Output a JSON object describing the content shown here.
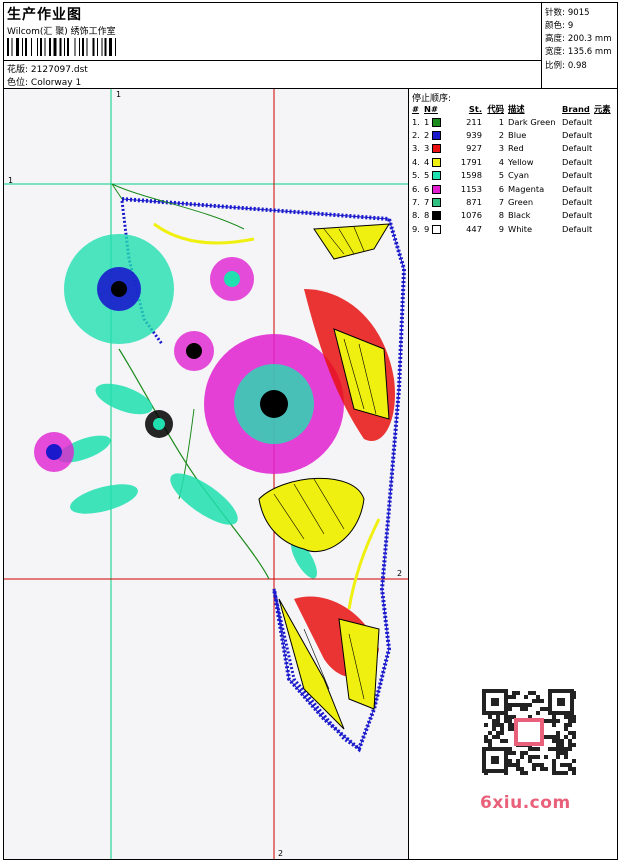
{
  "header": {
    "title": "生产作业图",
    "company": "Wilcom(汇 聚) 绣饰工作室",
    "design_label": "花版:",
    "design_value": "2127097.dst",
    "colorway_label": "色位:",
    "colorway_value": "Colorway 1"
  },
  "stats": [
    {
      "label": "针数:",
      "value": "9015"
    },
    {
      "label": "颜色:",
      "value": "9"
    },
    {
      "label": "高度:",
      "value": "200.3 mm"
    },
    {
      "label": "宽度:",
      "value": "135.6 mm"
    },
    {
      "label": "比例:",
      "value": "0.98"
    }
  ],
  "legend": {
    "title": "停止顺序:",
    "columns": [
      "#",
      "N#",
      "St.",
      "代码",
      "描述",
      "Brand",
      "元素"
    ],
    "rows": [
      {
        "n": "1.",
        "nn": "1",
        "color": "#1a8a1a",
        "st": "211",
        "code": "1",
        "desc": "Dark Green",
        "brand": "Default"
      },
      {
        "n": "2.",
        "nn": "2",
        "color": "#1a1acc",
        "st": "939",
        "code": "2",
        "desc": "Blue",
        "brand": "Default"
      },
      {
        "n": "3.",
        "nn": "3",
        "color": "#e81010",
        "st": "927",
        "code": "3",
        "desc": "Red",
        "brand": "Default"
      },
      {
        "n": "4.",
        "nn": "4",
        "color": "#f0f010",
        "st": "1791",
        "code": "4",
        "desc": "Yellow",
        "brand": "Default"
      },
      {
        "n": "5.",
        "nn": "5",
        "color": "#20e0b0",
        "st": "1598",
        "code": "5",
        "desc": "Cyan",
        "brand": "Default"
      },
      {
        "n": "6.",
        "nn": "6",
        "color": "#e020d0",
        "st": "1153",
        "code": "6",
        "desc": "Magenta",
        "brand": "Default"
      },
      {
        "n": "7.",
        "nn": "7",
        "color": "#30c080",
        "st": "871",
        "code": "7",
        "desc": "Green",
        "brand": "Default"
      },
      {
        "n": "8.",
        "nn": "8",
        "color": "#000000",
        "st": "1076",
        "code": "8",
        "desc": "Black",
        "brand": "Default"
      },
      {
        "n": "9.",
        "nn": "9",
        "color": "#ffffff",
        "st": "447",
        "code": "9",
        "desc": "White",
        "brand": "Default"
      }
    ]
  },
  "axes": {
    "v1": "1",
    "h1": "1",
    "v2": "2",
    "h2": "2"
  },
  "watermark": "6xiu.com",
  "colors": {
    "grid_green": "#00d080",
    "grid_red": "#d00000"
  }
}
